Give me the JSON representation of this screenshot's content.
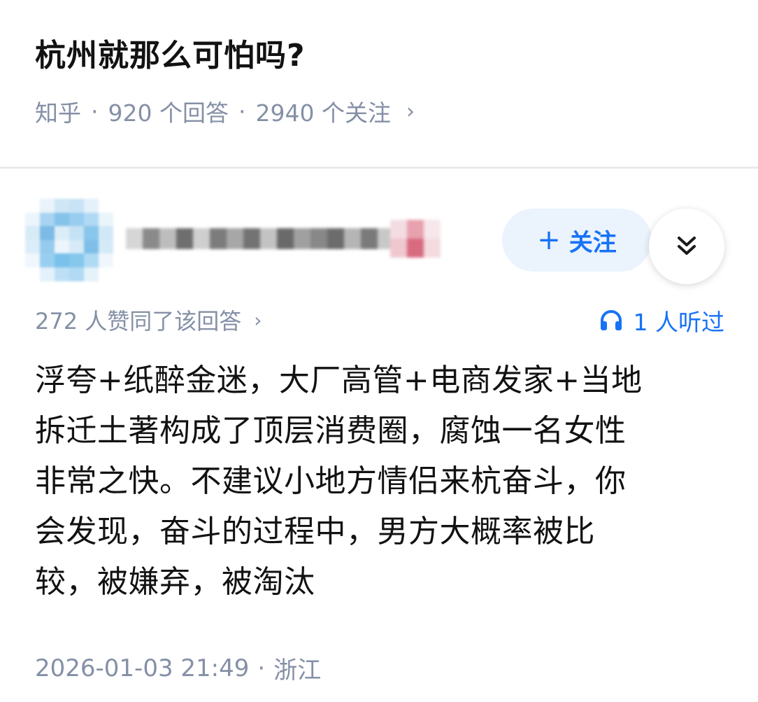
{
  "question": {
    "title": "杭州就那么可怕吗?",
    "source": "知乎",
    "separator": "·",
    "answers": "920 个回答",
    "followers": "2940 个关注",
    "chevron": "›"
  },
  "author": {
    "follow_plus": "+",
    "follow_label": "关注"
  },
  "stats": {
    "upvotes": "272 人赞同了该回答",
    "chevron": "›",
    "listened": "1 人听过"
  },
  "answer": {
    "lines": [
      "浮夸+纸醉金迷，大厂高管+电商发家+当地",
      "拆迁土著构成了顶层消费圈，腐蚀一名女性",
      "非常之快。不建议小地方情侣来杭奋斗，你",
      "会发现，奋斗的过程中，男方大概率被比",
      "较，被嫌弃，被淘汰"
    ]
  },
  "footer": {
    "datetime": "2026-01-03 21:49",
    "separator": "·",
    "location": "浙江"
  },
  "colors": {
    "accent": "#1772f6",
    "meta_gray": "#8590a6",
    "follow_bg": "#ebf3fd",
    "text": "#121212"
  },
  "icons": {
    "more": "double-chevron-down-icon",
    "headphones": "headphones-icon"
  }
}
